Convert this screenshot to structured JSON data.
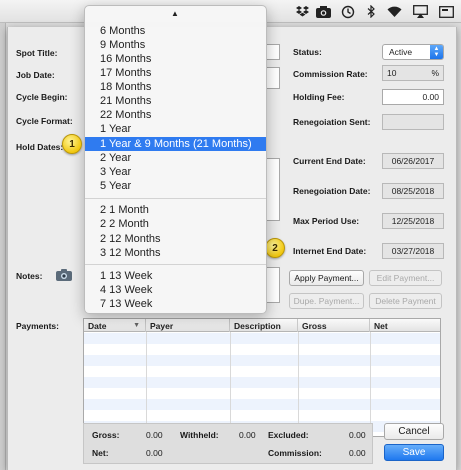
{
  "menubar": {
    "icons": [
      "dropbox-icon",
      "camera-icon",
      "time-machine-icon",
      "bluetooth-icon",
      "wifi-icon",
      "airplay-icon",
      "display-icon"
    ]
  },
  "form": {
    "spot_title_label": "Spot Title:",
    "job_date_label": "Job Date:",
    "cycle_begin_label": "Cycle Begin:",
    "cycle_format_label": "Cycle Format:",
    "hold_dates_label": "Hold Dates:",
    "notes_label": "Notes:",
    "payments_label": "Payments:",
    "status_label": "Status:",
    "status_value": "Active",
    "commission_rate_label": "Commission Rate:",
    "commission_rate_value": "10",
    "commission_rate_unit": "%",
    "holding_fee_label": "Holding Fee:",
    "holding_fee_value": "0.00",
    "renegotiation_sent_label": "Renegoiation Sent:",
    "current_end_date_label": "Current End Date:",
    "current_end_date_value": "06/26/2017",
    "renegotiation_date_label": "Renegoiation Date:",
    "renegotiation_date_value": "08/25/2018",
    "max_period_use_label": "Max Period Use:",
    "max_period_use_value": "12/25/2018",
    "internet_end_date_label": "Internet End Date:",
    "internet_end_date_value": "03/27/2018"
  },
  "buttons": {
    "apply_payment": "Apply Payment...",
    "edit_payment": "Edit Payment...",
    "dupe_payment": "Dupe. Payment...",
    "delete_payment": "Delete Payment",
    "cancel": "Cancel",
    "save": "Save"
  },
  "payments_table": {
    "columns": [
      "Date",
      "Payer",
      "Description",
      "Gross",
      "Net"
    ],
    "rows": []
  },
  "summary": {
    "gross_label": "Gross:",
    "gross_value": "0.00",
    "withheld_label": "Withheld:",
    "withheld_value": "0.00",
    "excluded_label": "Excluded:",
    "excluded_value": "0.00",
    "net_label": "Net:",
    "net_value": "0.00",
    "commission_label": "Commission:",
    "commission_value": "0.00"
  },
  "popup_menu": {
    "groups": [
      [
        "6 Months",
        "9 Months",
        "16 Months",
        "17 Months",
        "18 Months",
        "21 Months",
        "22 Months",
        "1 Year",
        "1 Year & 9 Months (21 Months)",
        "2 Year",
        "3 Year",
        "5 Year"
      ],
      [
        "2 1 Month",
        "2 2 Month",
        "2 12 Months",
        "3 12 Months"
      ],
      [
        "1 13 Week",
        "4 13 Week",
        "7 13 Week"
      ]
    ],
    "selected": "1 Year & 9 Months (21 Months)"
  },
  "callouts": [
    "1",
    "2"
  ]
}
